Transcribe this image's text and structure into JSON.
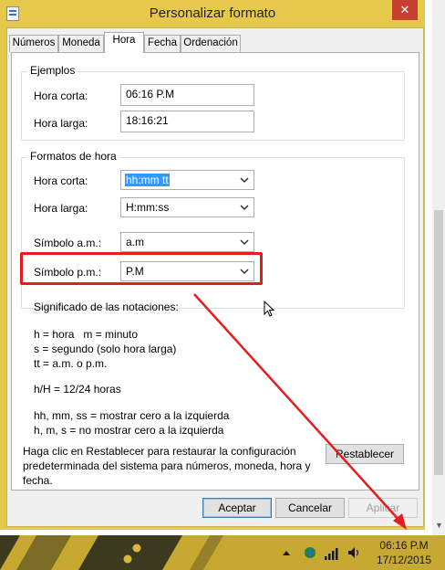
{
  "window": {
    "title": "Personalizar formato",
    "close_glyph": "✕"
  },
  "tabs": [
    {
      "label": "Números"
    },
    {
      "label": "Moneda"
    },
    {
      "label": "Hora"
    },
    {
      "label": "Fecha"
    },
    {
      "label": "Ordenación"
    }
  ],
  "active_tab": "Hora",
  "examples": {
    "group_title": "Ejemplos",
    "short_time_label": "Hora corta:",
    "short_time_value": "06:16 P.M",
    "long_time_label": "Hora larga:",
    "long_time_value": "18:16:21"
  },
  "formats": {
    "group_title": "Formatos de hora",
    "short_time_label": "Hora corta:",
    "short_time_value": "hh:mm tt",
    "long_time_label": "Hora larga:",
    "long_time_value": "H:mm:ss",
    "am_label": "Símbolo a.m.:",
    "am_value": "a.m",
    "pm_label": "Símbolo p.m.:",
    "pm_value": "P.M"
  },
  "notation": {
    "heading": "Significado de las notaciones:",
    "line1": "h = hora   m = minuto",
    "line2": "s = segundo (solo hora larga)",
    "line3": "tt = a.m. o p.m.",
    "line4": "h/H = 12/24 horas",
    "line5": "hh, mm, ss = mostrar cero a la izquierda",
    "line6": "h, m, s = no mostrar cero a la izquierda"
  },
  "reset": {
    "text_line1": "Haga clic en Restablecer para restaurar la configuración",
    "text_line2": "predeterminada del sistema para números, moneda, hora y",
    "text_line3": "fecha.",
    "button": "Restablecer"
  },
  "buttons": {
    "ok": "Aceptar",
    "cancel": "Cancelar",
    "apply": "Aplicar"
  },
  "taskbar": {
    "time": "06:16 P.M",
    "date": "17/12/2015"
  },
  "colors": {
    "annotation": "#e81c1c",
    "title_bar": "#e6c94a",
    "taskbar": "#c7a830",
    "selection": "#3399ff"
  },
  "icons": [
    "app-icon",
    "close-icon",
    "chevron-down-icon",
    "mouse-cursor-icon",
    "tray-up-arrow-icon",
    "network-icon",
    "signal-icon",
    "speaker-icon",
    "scroll-down-icon"
  ]
}
